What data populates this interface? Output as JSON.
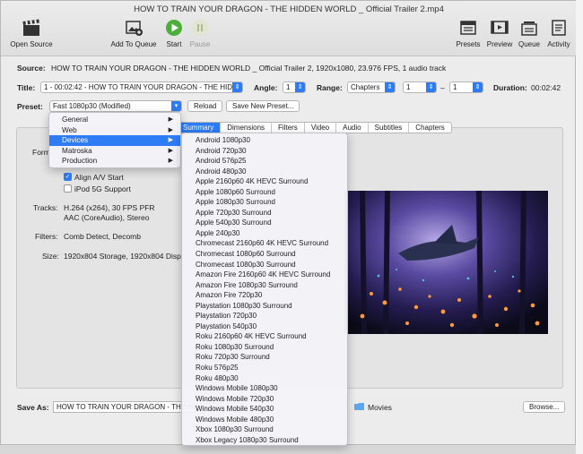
{
  "window": {
    "title": "HOW TO TRAIN YOUR DRAGON - THE HIDDEN WORLD _ Official Trailer 2.mp4"
  },
  "toolbar": {
    "open_source": "Open Source",
    "add_to_queue": "Add To Queue",
    "start": "Start",
    "pause": "Pause",
    "presets": "Presets",
    "preview": "Preview",
    "queue": "Queue",
    "activity": "Activity"
  },
  "source": {
    "label": "Source:",
    "value": "HOW TO TRAIN YOUR DRAGON - THE HIDDEN WORLD _ Official Trailer 2, 1920x1080, 23.976 FPS, 1 audio track"
  },
  "title_row": {
    "label": "Title:",
    "value": "1 - 00:02:42 - HOW TO TRAIN YOUR DRAGON - THE HIDDEN WORLD",
    "angle_label": "Angle:",
    "angle_value": "1",
    "range_label": "Range:",
    "range_value": "Chapters",
    "range_from": "1",
    "range_dash": "–",
    "range_to": "1",
    "duration_label": "Duration:",
    "duration_value": "00:02:42"
  },
  "preset_row": {
    "label": "Preset:",
    "value": "Fast 1080p30 (Modified)",
    "reload": "Reload",
    "save_new": "Save New Preset..."
  },
  "tabs": [
    "Summary",
    "Dimensions",
    "Filters",
    "Video",
    "Audio",
    "Subtitles",
    "Chapters"
  ],
  "summary": {
    "format_label": "Form",
    "align_av": "Align A/V Start",
    "ipod": "iPod 5G Support",
    "tracks_label": "Tracks:",
    "tracks_line1": "H.264 (x264), 30 FPS PFR",
    "tracks_line2": "AAC (CoreAudio), Stereo",
    "filters_label": "Filters:",
    "filters_value": "Comb Detect, Decomb",
    "size_label": "Size:",
    "size_value": "1920x804 Storage, 1920x804 Disp"
  },
  "category_menu": [
    "General",
    "Web",
    "Devices",
    "Matroska",
    "Production"
  ],
  "devices_menu": [
    "Android 1080p30",
    "Android 720p30",
    "Android 576p25",
    "Android 480p30",
    "Apple 2160p60 4K HEVC Surround",
    "Apple 1080p60 Surround",
    "Apple 1080p30 Surround",
    "Apple 720p30 Surround",
    "Apple 540p30 Surround",
    "Apple 240p30",
    "Chromecast 2160p60 4K HEVC Surround",
    "Chromecast 1080p60 Surround",
    "Chromecast 1080p30 Surround",
    "Amazon Fire 2160p60 4K HEVC Surround",
    "Amazon Fire 1080p30 Surround",
    "Amazon Fire 720p30",
    "Playstation 1080p30 Surround",
    "Playstation 720p30",
    "Playstation 540p30",
    "Roku 2160p60 4K HEVC Surround",
    "Roku 1080p30 Surround",
    "Roku 720p30 Surround",
    "Roku 576p25",
    "Roku 480p30",
    "Windows Mobile 1080p30",
    "Windows Mobile 720p30",
    "Windows Mobile 540p30",
    "Windows Mobile 480p30",
    "Xbox 1080p30 Surround",
    "Xbox Legacy 1080p30 Surround"
  ],
  "save_as": {
    "label": "Save As:",
    "value": "HOW TO TRAIN YOUR DRAGON - THE HIDDEN WORLD _ Official Trailer 2.mp4",
    "folder": "Movies",
    "browse": "Browse..."
  },
  "colors": {
    "accent": "#2d7cf6",
    "start_green": "#4caf3a"
  }
}
